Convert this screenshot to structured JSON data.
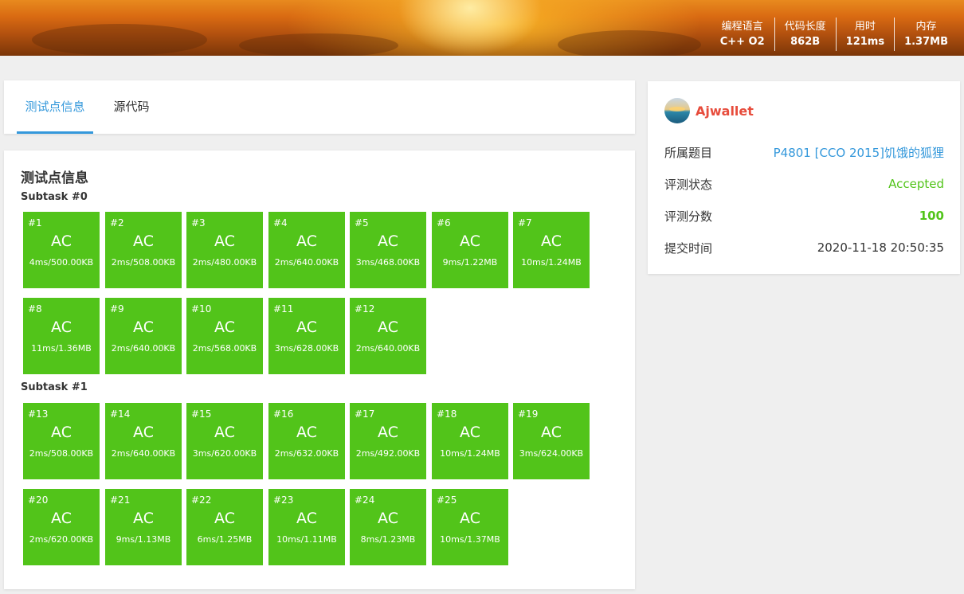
{
  "header": {
    "stats": [
      {
        "label": "编程语言",
        "value": "C++ O2"
      },
      {
        "label": "代码长度",
        "value": "862B"
      },
      {
        "label": "用时",
        "value": "121ms"
      },
      {
        "label": "内存",
        "value": "1.37MB"
      }
    ]
  },
  "tabs": [
    {
      "label": "测试点信息",
      "active": true
    },
    {
      "label": "源代码",
      "active": false
    }
  ],
  "tests": {
    "title": "测试点信息",
    "subtasks": [
      {
        "label": "Subtask #0",
        "cases": [
          {
            "id": "#1",
            "status": "AC",
            "result": "4ms/500.00KB"
          },
          {
            "id": "#2",
            "status": "AC",
            "result": "2ms/508.00KB"
          },
          {
            "id": "#3",
            "status": "AC",
            "result": "2ms/480.00KB"
          },
          {
            "id": "#4",
            "status": "AC",
            "result": "2ms/640.00KB"
          },
          {
            "id": "#5",
            "status": "AC",
            "result": "3ms/468.00KB"
          },
          {
            "id": "#6",
            "status": "AC",
            "result": "9ms/1.22MB"
          },
          {
            "id": "#7",
            "status": "AC",
            "result": "10ms/1.24MB"
          },
          {
            "id": "#8",
            "status": "AC",
            "result": "11ms/1.36MB"
          },
          {
            "id": "#9",
            "status": "AC",
            "result": "2ms/640.00KB"
          },
          {
            "id": "#10",
            "status": "AC",
            "result": "2ms/568.00KB"
          },
          {
            "id": "#11",
            "status": "AC",
            "result": "3ms/628.00KB"
          },
          {
            "id": "#12",
            "status": "AC",
            "result": "2ms/640.00KB"
          }
        ]
      },
      {
        "label": "Subtask #1",
        "cases": [
          {
            "id": "#13",
            "status": "AC",
            "result": "2ms/508.00KB"
          },
          {
            "id": "#14",
            "status": "AC",
            "result": "2ms/640.00KB"
          },
          {
            "id": "#15",
            "status": "AC",
            "result": "3ms/620.00KB"
          },
          {
            "id": "#16",
            "status": "AC",
            "result": "2ms/632.00KB"
          },
          {
            "id": "#17",
            "status": "AC",
            "result": "2ms/492.00KB"
          },
          {
            "id": "#18",
            "status": "AC",
            "result": "10ms/1.24MB"
          },
          {
            "id": "#19",
            "status": "AC",
            "result": "3ms/624.00KB"
          },
          {
            "id": "#20",
            "status": "AC",
            "result": "2ms/620.00KB"
          },
          {
            "id": "#21",
            "status": "AC",
            "result": "9ms/1.13MB"
          },
          {
            "id": "#22",
            "status": "AC",
            "result": "6ms/1.25MB"
          },
          {
            "id": "#23",
            "status": "AC",
            "result": "10ms/1.11MB"
          },
          {
            "id": "#24",
            "status": "AC",
            "result": "8ms/1.23MB"
          },
          {
            "id": "#25",
            "status": "AC",
            "result": "10ms/1.37MB"
          }
        ]
      }
    ]
  },
  "info": {
    "username": "Ajwallet",
    "rows": {
      "problem": {
        "label": "所属题目",
        "value": "P4801 [CCO 2015]饥饿的狐狸"
      },
      "status": {
        "label": "评测状态",
        "value": "Accepted"
      },
      "score": {
        "label": "评测分数",
        "value": "100"
      },
      "time": {
        "label": "提交时间",
        "value": "2020-11-18 20:50:35"
      }
    }
  },
  "colors": {
    "ac_green": "#52c41a",
    "accent_blue": "#3498db",
    "username_red": "#e74c3c"
  }
}
